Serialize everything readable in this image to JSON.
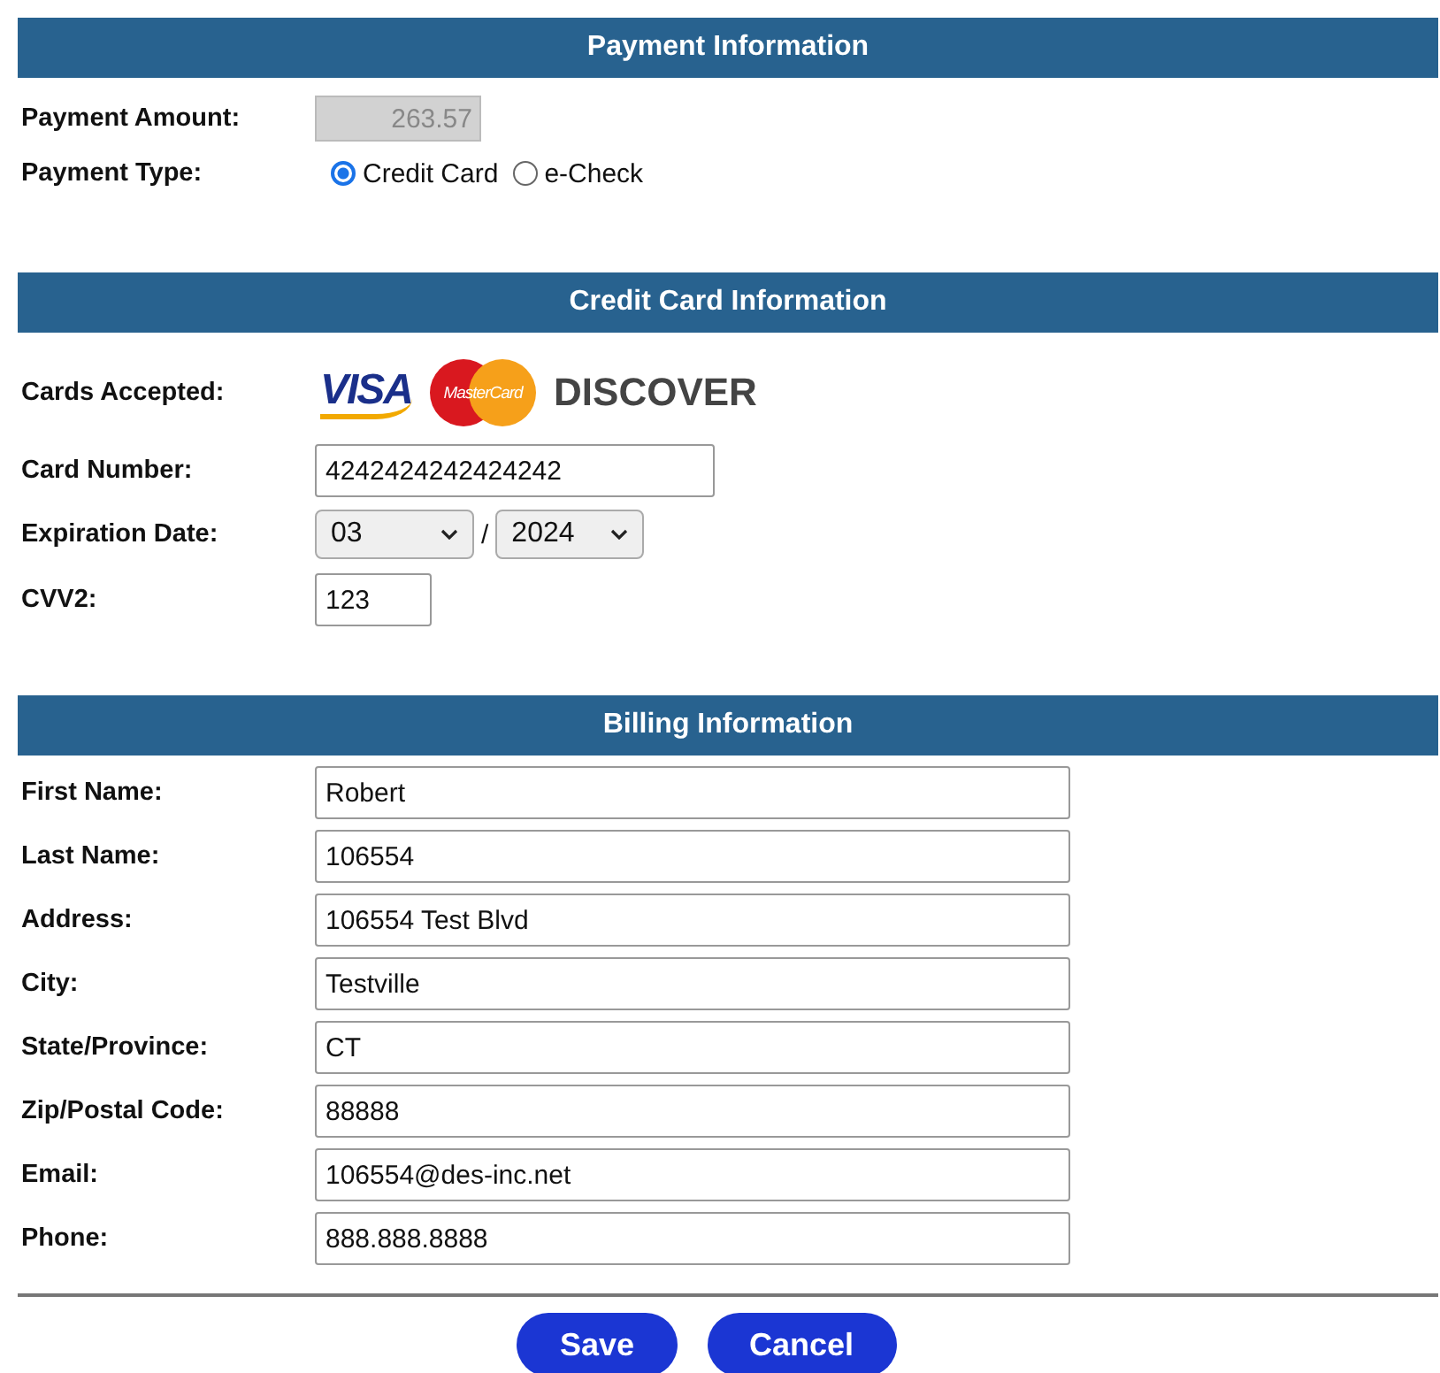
{
  "payment_section": {
    "title": "Payment Information",
    "amount_label": "Payment Amount:",
    "amount_value": "263.57",
    "amount_disabled": true,
    "type_label": "Payment Type:",
    "payment_types": [
      {
        "label": "Credit Card",
        "selected": true
      },
      {
        "label": "e-Check",
        "selected": false
      }
    ]
  },
  "card_section": {
    "title": "Credit Card Information",
    "cards_label": "Cards Accepted:",
    "cards": [
      {
        "kind": "visa",
        "text": "VISA"
      },
      {
        "kind": "mastercard",
        "text": "MasterCard"
      },
      {
        "kind": "discover",
        "text": "DISCOVER"
      }
    ],
    "number_label": "Card Number:",
    "number_value": "4242424242424242",
    "expiration_label": "Expiration Date:",
    "month": "03",
    "separator": "/",
    "year": "2024",
    "cvv_label": "CVV2:",
    "cvv_value": "123"
  },
  "billing_section": {
    "title": "Billing Information",
    "fields": [
      {
        "label": "First Name:",
        "value": "Robert"
      },
      {
        "label": "Last Name:",
        "value": "106554"
      },
      {
        "label": "Address:",
        "value": "106554 Test Blvd"
      },
      {
        "label": "City:",
        "value": "Testville"
      },
      {
        "label": "State/Province:",
        "value": "CT"
      },
      {
        "label": "Zip/Postal Code:",
        "value": "88888"
      },
      {
        "label": "Email:",
        "value": "106554@des-inc.net"
      },
      {
        "label": "Phone:",
        "value": "888.888.8888"
      }
    ]
  },
  "buttons": [
    "Save",
    "Cancel"
  ]
}
